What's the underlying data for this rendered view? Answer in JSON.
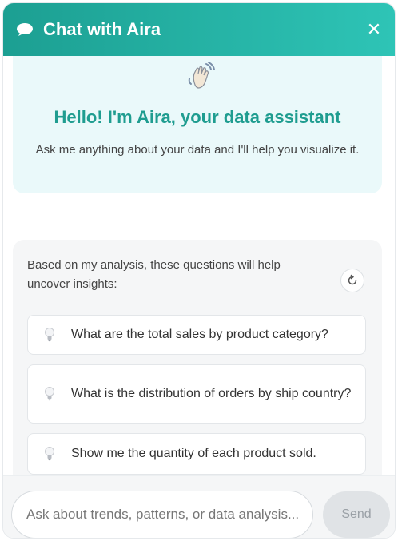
{
  "header": {
    "title": "Chat with Aira",
    "chat_icon": "chat-bubble-icon",
    "close_label": "✕",
    "accent": "#2ec4b6"
  },
  "welcome": {
    "icon": "waving-hand-icon",
    "greeting": "Hello! I'm Aira, your data assistant",
    "subtitle": "Ask me anything about your data and I'll help you visualize it."
  },
  "suggestions": {
    "intro": "Based on my analysis, these questions will help uncover insights:",
    "refresh_icon": "refresh-icon",
    "items": [
      {
        "icon": "lightbulb-icon",
        "text": "What are the total sales by product category?"
      },
      {
        "icon": "lightbulb-icon",
        "text": "What is the distribution of orders by ship country?"
      },
      {
        "icon": "lightbulb-icon",
        "text": "Show me the quantity of each product sold."
      }
    ]
  },
  "composer": {
    "placeholder": "Ask about trends, patterns, or data analysis...",
    "value": "",
    "send_label": "Send"
  }
}
